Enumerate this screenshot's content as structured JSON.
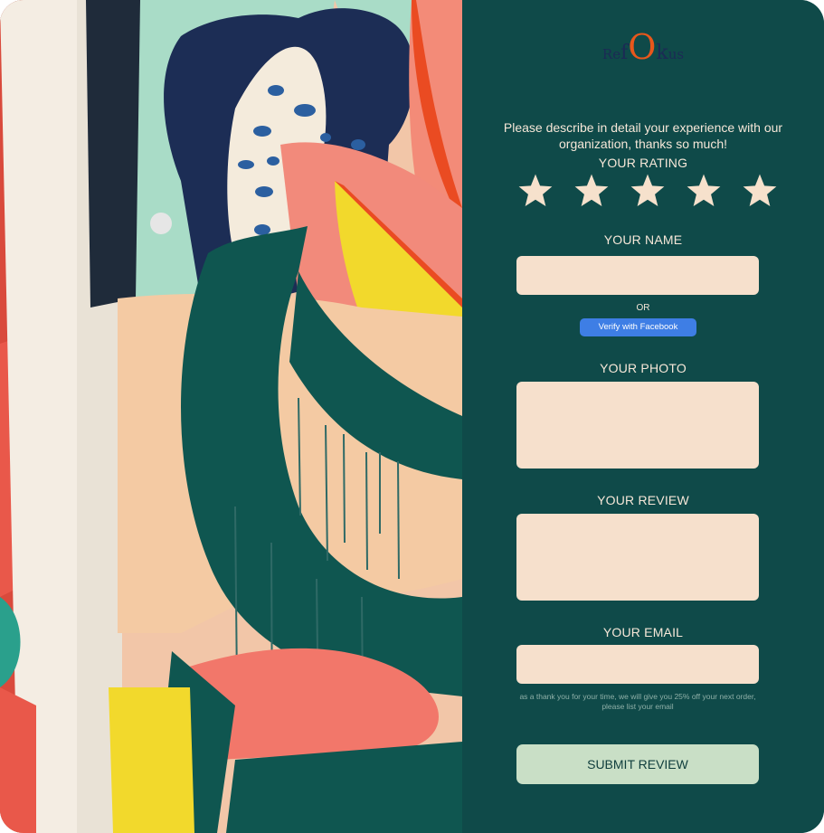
{
  "brand": {
    "logo_parts": [
      "R",
      "e",
      "f",
      "O",
      "k",
      "u",
      "s"
    ],
    "logo_color": "#1c2a55",
    "accent_color": "#e8571b"
  },
  "form": {
    "intro": "Please describe in detail your experience with our organization, thanks so much!",
    "rating_label": "YOUR RATING",
    "rating": {
      "filled": 5,
      "max": 5
    },
    "name_label": "YOUR  NAME",
    "name_value": "",
    "or_label": "OR",
    "facebook_button": "Verify with Facebook",
    "photo_label": "YOUR PHOTO",
    "review_label": "YOUR REVIEW",
    "review_value": "",
    "email_label": "YOUR EMAIL",
    "email_value": "",
    "email_note": "as a thank you for your time, we will give you 25% off your next order, please list your email",
    "submit_label": "SUBMIT REVIEW"
  },
  "colors": {
    "panel_bg": "#0f4a49",
    "field_bg": "#f6e0cc",
    "star_color": "#f6e1cc",
    "facebook_blue": "#3e7ee5",
    "submit_bg": "#c9dfc6"
  },
  "icons": {
    "star": "star-icon"
  }
}
